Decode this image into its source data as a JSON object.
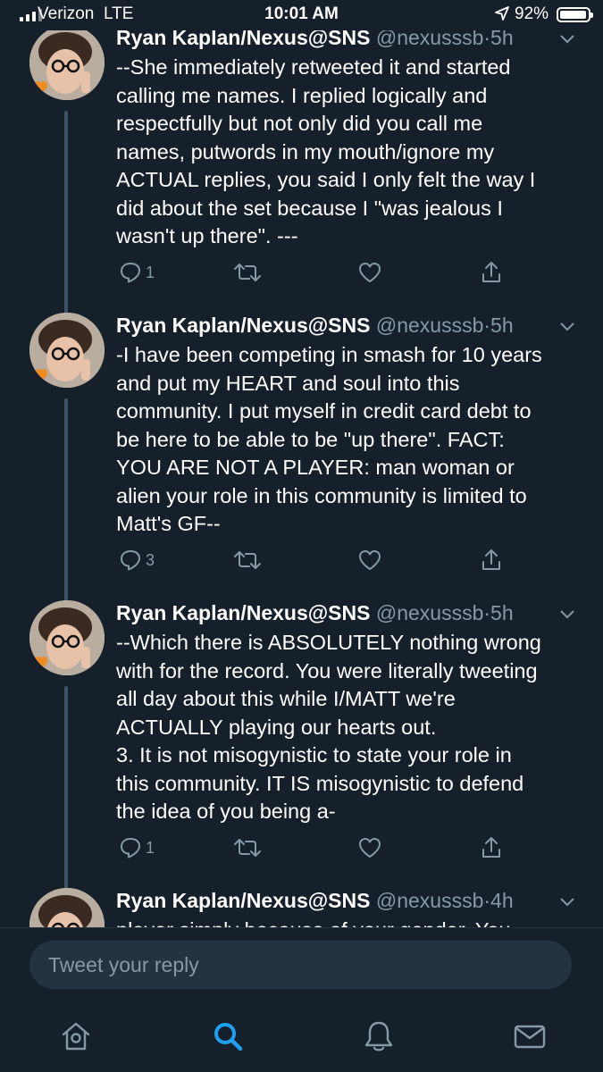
{
  "status_bar": {
    "carrier": "Verizon",
    "network": "LTE",
    "time": "10:01 AM",
    "battery": "92%",
    "battery_level": 0.92
  },
  "tweets": [
    {
      "name": "Ryan Kaplan/Nexus@SNS",
      "handle": "@nexusssb",
      "sep": "·",
      "time": "5h",
      "text": "--She immediately retweeted it and started\ncalling me names. I replied logically and\nrespectfully but not only did you call me\nnames, putwords in my mouth/ignore my\nACTUAL replies, you said I only felt the way I\ndid about the set because I \"was jealous I\nwasn't up there\". ---",
      "reply_count": "1"
    },
    {
      "name": "Ryan Kaplan/Nexus@SNS",
      "handle": "@nexusssb",
      "sep": "·",
      "time": "5h",
      "text": "-I have been competing in smash for 10 years\nand put my HEART and soul into this\ncommunity. I put myself in credit card debt to\nbe here to be able to be \"up there\". FACT:\nYOU ARE NOT A PLAYER: man woman or\nalien your role in this community is limited to\nMatt's GF--",
      "reply_count": "3"
    },
    {
      "name": "Ryan Kaplan/Nexus@SNS",
      "handle": "@nexusssb",
      "sep": "·",
      "time": "5h",
      "text": "--Which there is ABSOLUTELY nothing wrong\nwith for the record. You were literally tweeting\nall day about this while I/MATT we're\nACTUALLY playing our hearts out.\n3. It is not misogynistic to state your role in\nthis community. IT IS misogynistic to defend\nthe idea of you being a-",
      "reply_count": "1"
    },
    {
      "name": "Ryan Kaplan/Nexus@SNS",
      "handle": "@nexusssb",
      "sep": "·",
      "time": "4h",
      "text": "player simply because of your gender. You"
    }
  ],
  "reply_bar": {
    "placeholder": "Tweet your reply"
  },
  "tab_bar": [
    {
      "icon": "home-icon"
    },
    {
      "icon": "search-icon",
      "active": true
    },
    {
      "icon": "bell-icon"
    },
    {
      "icon": "mail-icon"
    }
  ],
  "colors": {
    "background": "#15202b",
    "secondary_text": "#8899a6",
    "accent": "#1da1f2",
    "thread_line": "#3d5466",
    "input_bg": "#253341"
  }
}
